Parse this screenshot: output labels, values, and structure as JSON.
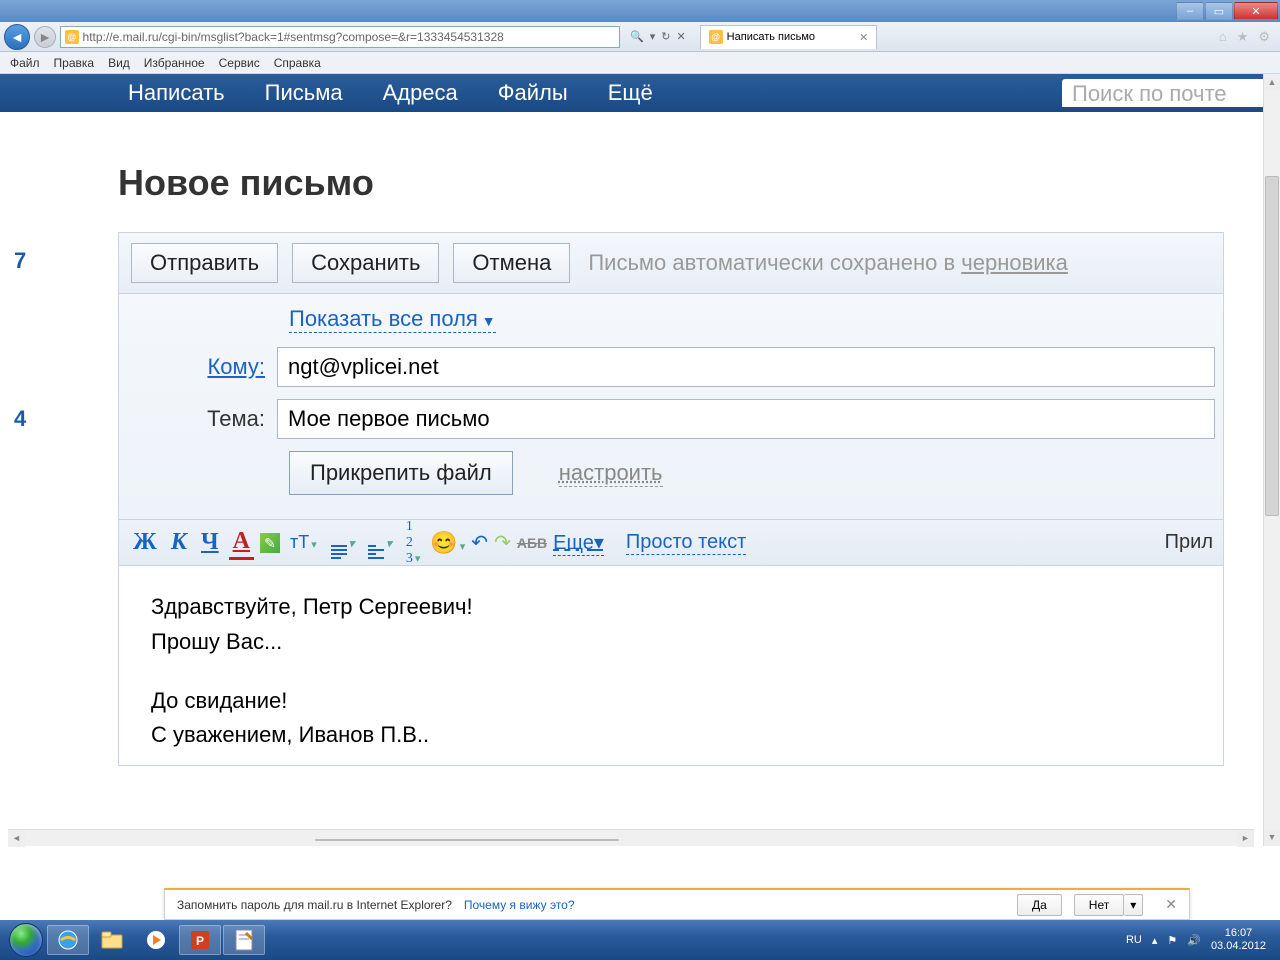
{
  "window": {
    "title": "Написать письмо"
  },
  "ie": {
    "url": "http://e.mail.ru/cgi-bin/msglist?back=1#sentmsg?compose=&r=1333454531328",
    "tab_title": "Написать письмо",
    "menu": [
      "Файл",
      "Правка",
      "Вид",
      "Избранное",
      "Сервис",
      "Справка"
    ]
  },
  "mail_nav": {
    "items": [
      "Написать",
      "Письма",
      "Адреса",
      "Файлы",
      "Ещё"
    ],
    "search_placeholder": "Поиск по почте"
  },
  "compose": {
    "heading": "Новое письмо",
    "send": "Отправить",
    "save": "Сохранить",
    "cancel": "Отмена",
    "autosave_prefix": "Письмо автоматически сохранено в ",
    "autosave_link": "черновика",
    "show_all_fields": "Показать все поля",
    "to_label": "Кому:",
    "to_value": "ngt@vplicei.net",
    "subject_label": "Тема:",
    "subject_value": "Мое первое письмо",
    "attach": "Прикрепить файл",
    "settings": "настроить"
  },
  "toolbar": {
    "bold": "Ж",
    "italic": "К",
    "underline": "Ч",
    "color": "А",
    "size": "тТ",
    "strike": "АБВ",
    "more": "Еще",
    "plain": "Просто текст",
    "attach_right": "Прил"
  },
  "body": {
    "l1": "Здравствуйте, Петр Сергеевич!",
    "l2": "Прошу Вас...",
    "l3": "До свидание!",
    "l4": "С уважением, Иванов П.В.."
  },
  "left_nums": [
    "7",
    "4"
  ],
  "passbar": {
    "text": "Запомнить пароль для mail.ru в Internet Explorer?",
    "why": "Почему я вижу это?",
    "yes": "Да",
    "no": "Нет"
  },
  "tray": {
    "lang": "RU",
    "time": "16:07",
    "date": "03.04.2012"
  }
}
